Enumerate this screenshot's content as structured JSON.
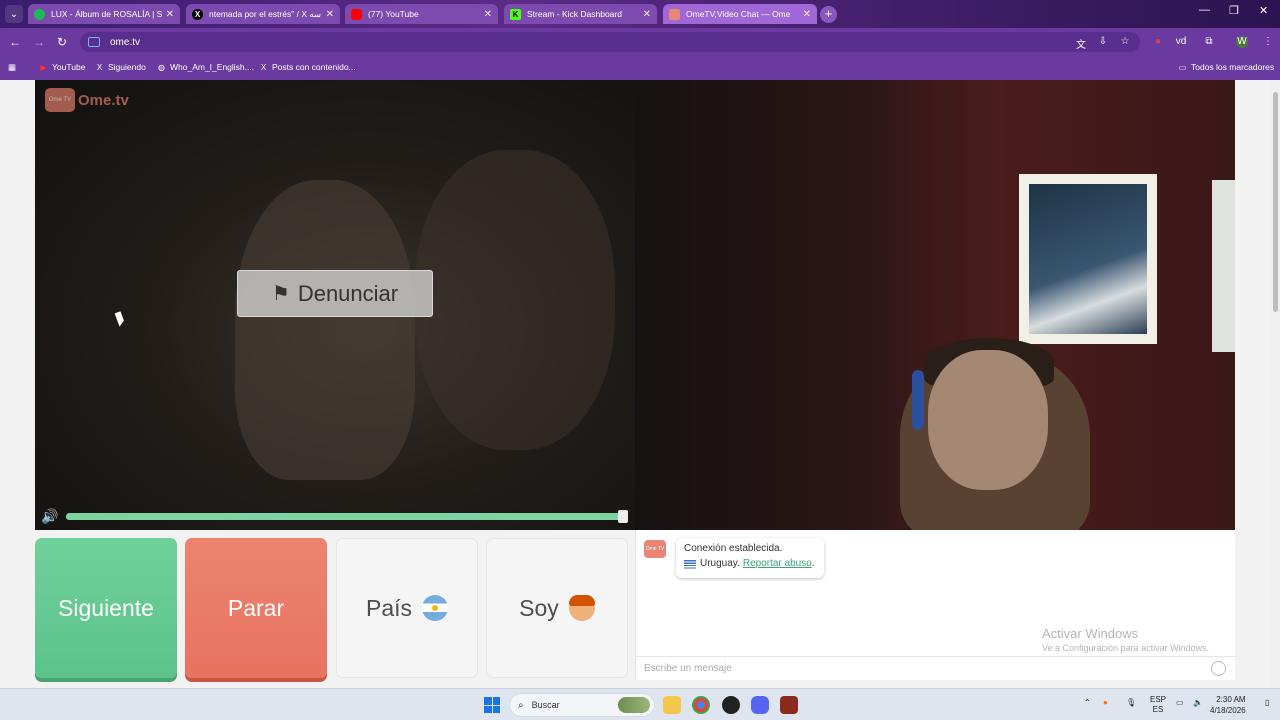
{
  "browser": {
    "tabs": [
      {
        "title": "LUX - Álbum de ROSALÍA | Spo",
        "favicon": "spotify-icon",
        "color": "#1db954"
      },
      {
        "title": "ntemada por el estrés\" / X سه",
        "favicon": "x-icon",
        "color": "#000000"
      },
      {
        "title": "(77) YouTube",
        "favicon": "youtube-icon",
        "color": "#ff0000"
      },
      {
        "title": "Stream - Kick Dashboard",
        "favicon": "kick-icon",
        "color": "#53fc18"
      },
      {
        "title": "OmeTV,Video Chat — Ome",
        "favicon": "ometv-icon",
        "color": "#e98575"
      }
    ],
    "url": "ome.tv",
    "bookmarks": [
      {
        "label": "YouTube",
        "icon": "youtube-icon"
      },
      {
        "label": "Siguiendo",
        "icon": "x-icon"
      },
      {
        "label": "Who_Am_I_English....",
        "icon": "globe-icon"
      },
      {
        "label": "Posts con contenido...",
        "icon": "x-icon"
      }
    ],
    "all_bookmarks": "Todos los marcadores"
  },
  "app": {
    "logo": "Ome.tv",
    "logo_badge": "Ome TV",
    "report_label": "Denunciar",
    "volume_level": 1.0
  },
  "controls": {
    "next": "Siguiente",
    "stop": "Parar",
    "country": "País",
    "iam": "Soy"
  },
  "chat": {
    "connection": "Conexión establecida.",
    "country": "Uruguay.",
    "report_abuse": "Reportar abuso",
    "placeholder": "Escribe un mensaje",
    "watermark_title": "Activar Windows",
    "watermark_sub": "Ve a Configuración para activar Windows."
  },
  "taskbar": {
    "search": "Buscar",
    "lang1": "ESP",
    "lang2": "ES",
    "time": "2:30 AM",
    "date": "4/18/2026"
  }
}
